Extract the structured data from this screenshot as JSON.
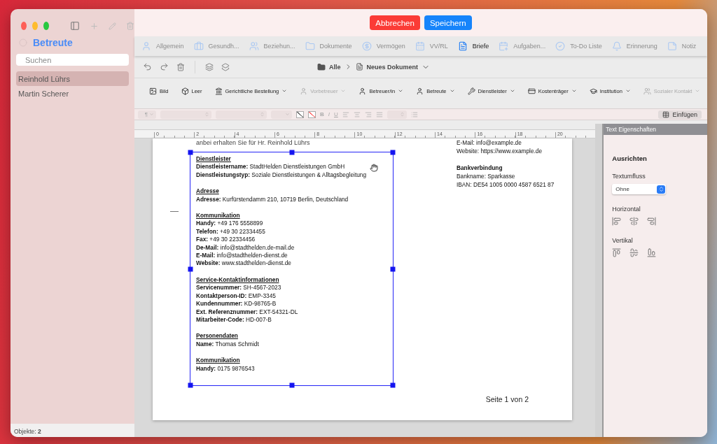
{
  "sidebar": {
    "title": "Betreute",
    "search": {
      "placeholder": "Suchen"
    },
    "items": [
      {
        "label": "Reinhold Lührs",
        "selected": true
      },
      {
        "label": "Martin Scherer",
        "selected": false
      }
    ],
    "footer": "Objekte: **2**"
  },
  "top_actions": [
    {
      "label": "Abbrechen",
      "kind": "cancel"
    },
    {
      "label": "Speichern",
      "kind": "save"
    }
  ],
  "tabs": [
    {
      "label": "Allgemein",
      "selected": false
    },
    {
      "label": "Gesundh...",
      "selected": false
    },
    {
      "label": "Beziehun...",
      "selected": false
    },
    {
      "label": "Dokumente",
      "selected": false
    },
    {
      "label": "Vermögen",
      "selected": false
    },
    {
      "label": "VV/RL",
      "selected": false
    },
    {
      "label": "Briefe",
      "selected": true
    },
    {
      "label": "Aufgaben...",
      "selected": false
    },
    {
      "label": "To-Do Liste",
      "selected": false
    },
    {
      "label": "Erinnerung",
      "selected": false
    },
    {
      "label": "Notiz",
      "selected": false
    }
  ],
  "breadcrumb": [
    "Alle",
    "Neues Dokument"
  ],
  "insert_tools": [
    {
      "label": "Bild",
      "dropdown": false,
      "disabled": false
    },
    {
      "label": "Leer",
      "dropdown": false,
      "disabled": false
    },
    {
      "label": "Gerichtliche Bestellung",
      "dropdown": true,
      "disabled": false
    },
    {
      "label": "Vorbetreuer",
      "dropdown": true,
      "disabled": true
    },
    {
      "label": "Betreuer/in",
      "dropdown": true,
      "disabled": false
    },
    {
      "label": "Betreute",
      "dropdown": true,
      "disabled": false
    },
    {
      "label": "Dienstleister",
      "dropdown": true,
      "disabled": false
    },
    {
      "label": "Kostenträger",
      "dropdown": true,
      "disabled": false
    },
    {
      "label": "Institution",
      "dropdown": true,
      "disabled": false
    },
    {
      "label": "Sozialer Kontakt",
      "dropdown": true,
      "disabled": true
    }
  ],
  "format_bar": {
    "paragraph": "¶",
    "bold": "B",
    "italic": "I",
    "underline": "U",
    "insert": "Einfügen"
  },
  "ruler": [
    "0",
    "2",
    "4",
    "6",
    "8",
    "10",
    "12",
    "14",
    "16",
    "18",
    "20"
  ],
  "document": {
    "intro": "anbei erhalten Sie für Hr. Reinhold Lührs",
    "frame_sections": [
      {
        "heading": "Dienstleister",
        "lines": [
          "**Dienstleistername:** StadtHelden Dienstleistungen GmbH",
          "**Dienstleistungstyp:** Soziale Dienstleistungen & Alltagsbegleitung"
        ]
      },
      {
        "heading": "Adresse",
        "lines": [
          "**Adresse:** Kurfürstendamm 210, 10719 Berlin, Deutschland"
        ]
      },
      {
        "heading": "Kommunikation",
        "lines": [
          "**Handy:** +49 176 5558899",
          "**Telefon:** +49 30 22334455",
          "**Fax:** +49 30 22334456",
          "**De-Mail:** info@stadthelden.de-mail.de",
          "**E-Mail:** info@stadthelden-dienst.de",
          "**Website:** www.stadthelden-dienst.de"
        ]
      },
      {
        "heading": "Service-Kontaktinformationen",
        "lines": [
          "**Servicenummer:** SH-4567-2023",
          "**Kontaktperson-ID:** EMP-3345",
          "**Kundennummer:** KD-98765-B",
          "**Ext. Referenznummer:** EXT-54321-DL",
          "**Mitarbeiter-Code:** HD-007-B"
        ]
      },
      {
        "heading": "Personendaten",
        "lines": [
          "**Name:** Thomas Schmidt"
        ]
      },
      {
        "heading": "Kommunikation",
        "lines": [
          "**Handy:** 0175 9876543"
        ]
      }
    ],
    "side_column": [
      {
        "kind": "line",
        "text": "E-Mail: info@example.de"
      },
      {
        "kind": "line",
        "text": "Website: https://www.example.de"
      },
      {
        "kind": "heading",
        "text": "Bankverbindung"
      },
      {
        "kind": "line",
        "text": "Bankname: Sparkasse"
      },
      {
        "kind": "line",
        "text": "IBAN: DE54 1005 0000 4587 6521 87"
      }
    ],
    "page_footer": "Seite 1 von 2"
  },
  "properties_panel": {
    "title": "Text Eigenschaften",
    "heading": "Ausrichten",
    "wrap_label": "Textumfluss",
    "wrap_value": "Ohne",
    "horizontal_label": "Horizontal",
    "vertical_label": "Vertikal"
  }
}
